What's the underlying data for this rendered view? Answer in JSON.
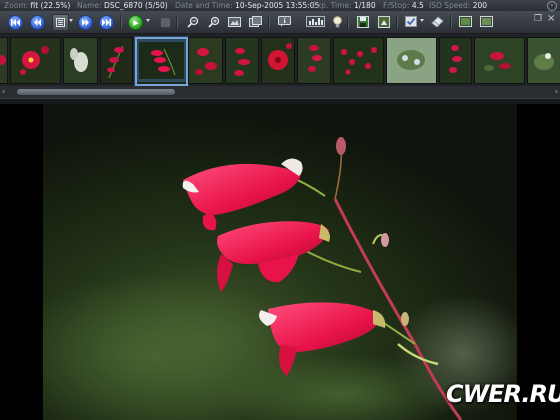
{
  "info_bar": {
    "zoom_label": "Zoom:",
    "zoom_value": "fit (22.5%)",
    "name_label": "Name:",
    "name_value": "DSC_6870 (5/50)",
    "datetime_label": "Date and Time:",
    "datetime_value": "10-Sep-2005 13:55:05",
    "exposure_label": "Exp. Time:",
    "exposure_value": "1/180",
    "fstop_label": "F/Stop:",
    "fstop_value": "4.5",
    "iso_label": "ISO Speed:",
    "iso_value": "200",
    "close_glyph": "›"
  },
  "toolbar": {
    "icons": [
      "first-image-icon",
      "previous-image-icon",
      "image-menu-icon",
      "next-image-icon",
      "last-image-icon",
      "play-slideshow-icon",
      "stop-slideshow-icon",
      "zoom-out-icon",
      "zoom-in-icon",
      "fit-to-window-icon",
      "full-screen-icon",
      "info-icon",
      "histogram-icon",
      "light-bulb-icon",
      "save-icon",
      "export-icon",
      "check-icon",
      "eraser-icon",
      "thumbnail-view-icon",
      "window-icon"
    ],
    "restore_glyph": "❐",
    "close_glyph": "×",
    "play_glyph": "▶"
  },
  "filmstrip": {
    "selected_index": 4
  },
  "scrollbar": {
    "left_glyph": "‹",
    "right_glyph": "›"
  },
  "watermark": {
    "text": "CWER.RU"
  },
  "colors": {
    "flower": "#e8134a",
    "stem": "#7a9a2e",
    "background_blur": "#2a3a1e",
    "selection": "#7aa4d8"
  }
}
